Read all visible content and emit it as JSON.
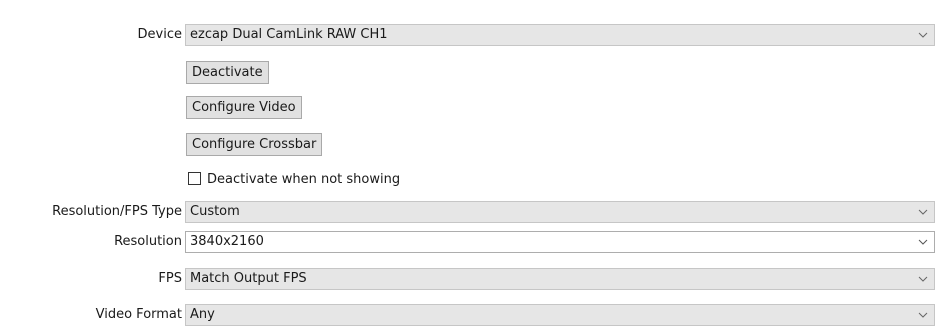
{
  "device": {
    "label": "Device",
    "value": "ezcap Dual CamLink RAW CH1"
  },
  "buttons": {
    "deactivate": "Deactivate",
    "configure_video": "Configure Video",
    "configure_crossbar": "Configure Crossbar"
  },
  "deactivate_when_not_showing": {
    "label": "Deactivate when not showing",
    "checked": false
  },
  "resolution_fps_type": {
    "label": "Resolution/FPS Type",
    "value": "Custom"
  },
  "resolution": {
    "label": "Resolution",
    "value": "3840x2160"
  },
  "fps": {
    "label": "FPS",
    "value": "Match Output FPS"
  },
  "video_format": {
    "label": "Video Format",
    "value": "Any"
  },
  "icons": {
    "dropdown": "chevron-down-icon",
    "checkbox": "checkbox-unchecked-icon"
  }
}
